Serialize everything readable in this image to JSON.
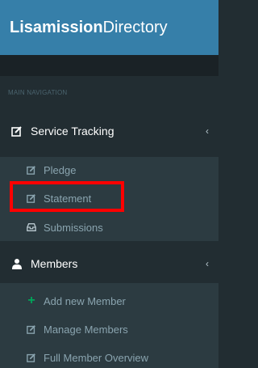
{
  "brand": {
    "bold": "Lisamission",
    "light": "Directory"
  },
  "nav": {
    "section_header": "MAIN NAVIGATION",
    "service_tracking": {
      "label": "Service Tracking",
      "chevron": "‹",
      "items": [
        {
          "label": "Pledge",
          "icon": "edit-icon"
        },
        {
          "label": "Statement",
          "icon": "edit-icon"
        },
        {
          "label": "Submissions",
          "icon": "inbox-icon"
        }
      ]
    },
    "members": {
      "label": "Members",
      "chevron": "‹",
      "items": [
        {
          "label": "Add new Member",
          "icon": "plus-icon"
        },
        {
          "label": "Manage Members",
          "icon": "edit-icon"
        },
        {
          "label": "Full Member Overview",
          "icon": "edit-icon"
        }
      ]
    }
  },
  "colors": {
    "sidebar_bg": "#222d32",
    "submenu_bg": "#2c3b41",
    "brand_bg": "#367fa9",
    "highlight": "#ff0000",
    "accent_green": "#00a65a"
  }
}
